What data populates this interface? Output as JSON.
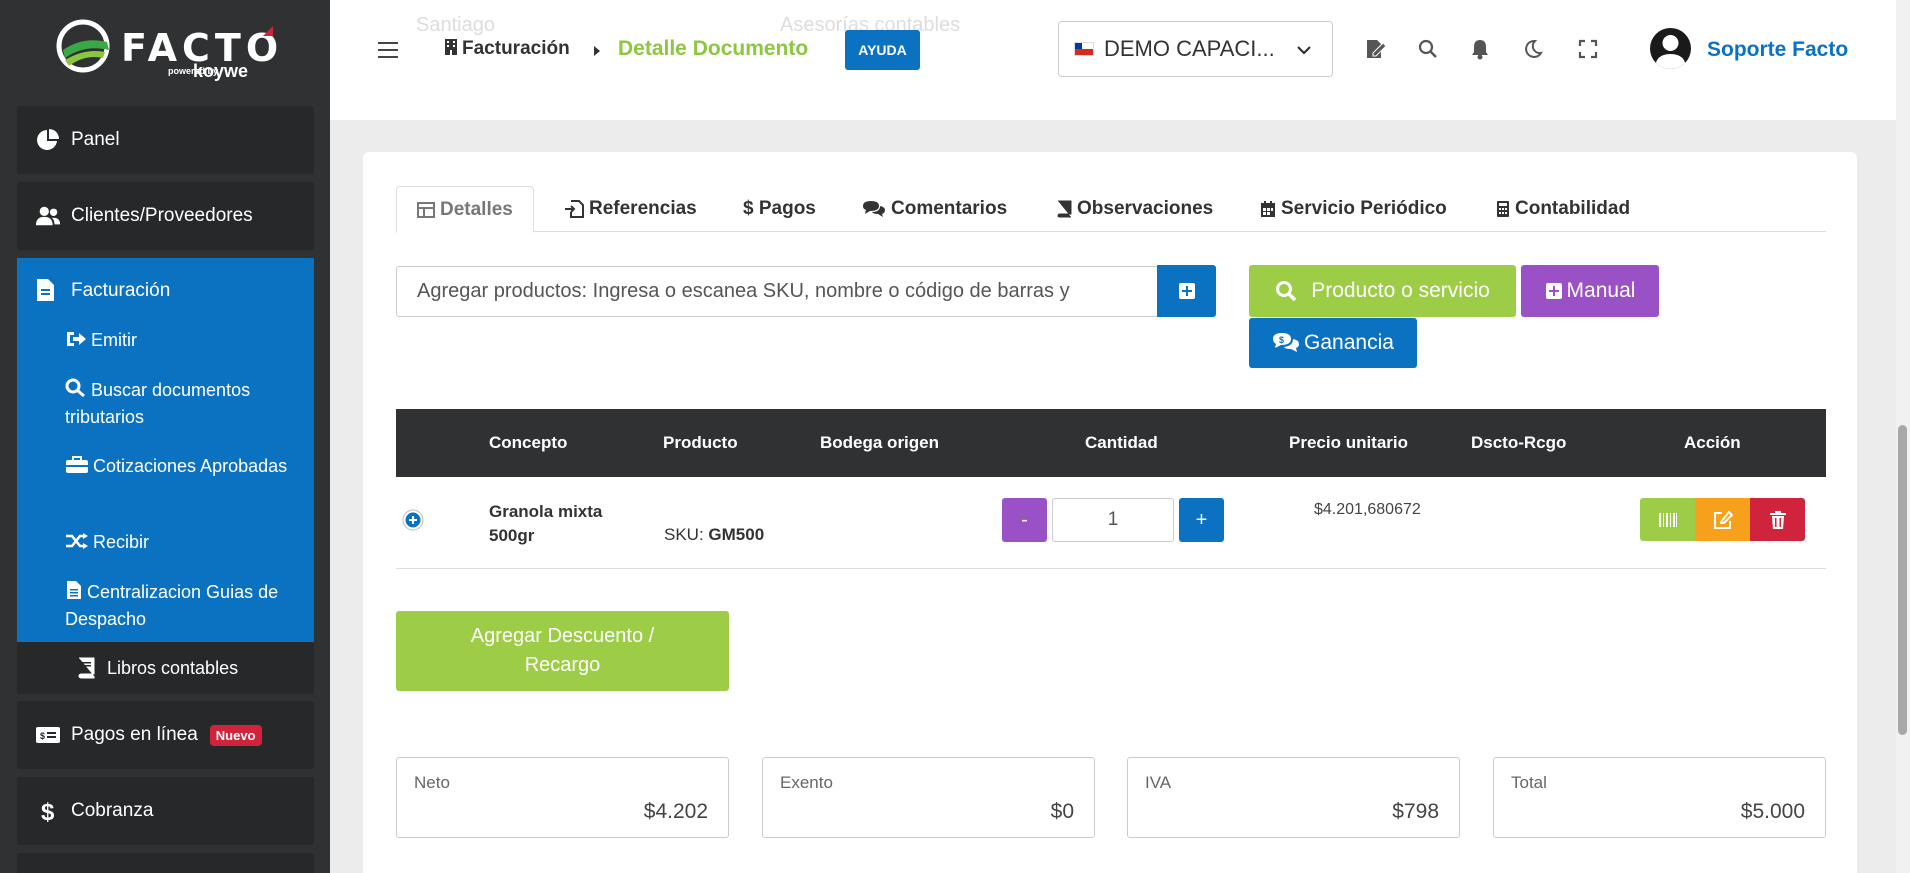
{
  "brand": {
    "name": "FACTO",
    "powered": "powered by",
    "sub": "koywe"
  },
  "sidebar": {
    "panel": "Panel",
    "clientes": "Clientes/Proveedores",
    "facturacion": "Facturación",
    "sub": {
      "emitir": "Emitir",
      "buscar": "Buscar documentos tributarios",
      "cotizaciones": "Cotizaciones Aprobadas",
      "recibir": "Recibir",
      "centralizacion": "Centralizacion Guias de Despacho"
    },
    "libros": "Libros contables",
    "pagos": "Pagos en línea",
    "pagos_badge": "Nuevo",
    "cobranza": "Cobranza"
  },
  "header": {
    "crumb1": "Facturación",
    "crumb2": "Detalle Documento",
    "ayuda": "AYUDA",
    "company": "DEMO CAPACI...",
    "user": "Soporte Facto",
    "ghost_left": "Santiago",
    "ghost_right": "Asesorías contables"
  },
  "tabs": {
    "detalles": "Detalles",
    "referencias": "Referencias",
    "pagos": "$ Pagos",
    "comentarios": "Comentarios",
    "observaciones": "Observaciones",
    "servicio": "Servicio Periódico",
    "contabilidad": "Contabilidad"
  },
  "products": {
    "placeholder": "Agregar productos: Ingresa o escanea SKU, nombre o código de barras y",
    "btn_producto": "Producto o servicio",
    "btn_manual": "Manual",
    "btn_ganancia": "Ganancia"
  },
  "table": {
    "headers": {
      "concepto": "Concepto",
      "producto": "Producto",
      "bodega": "Bodega origen",
      "cantidad": "Cantidad",
      "precio": "Precio unitario",
      "dscto": "Dscto-Rcgo",
      "accion": "Acción"
    },
    "row": {
      "concepto_line1": "Granola mixta",
      "concepto_line2": "500gr",
      "sku_label": "SKU:",
      "sku": "GM500",
      "qty_minus": "-",
      "qty": "1",
      "qty_plus": "+",
      "precio": "$4.201,680672"
    }
  },
  "descuento_btn": {
    "line1": "Agregar Descuento /",
    "line2": "Recargo"
  },
  "totals": {
    "neto_label": "Neto",
    "neto": "$4.202",
    "exento_label": "Exento",
    "exento": "$0",
    "iva_label": "IVA",
    "iva": "$798",
    "total_label": "Total",
    "total": "$5.000"
  },
  "colors": {
    "sidebar_bg": "#2f3132",
    "active_blue": "#0b72c1",
    "green": "#9dcc47",
    "purple": "#9b51c6",
    "orange": "#f7a01c",
    "red": "#d0243c"
  }
}
